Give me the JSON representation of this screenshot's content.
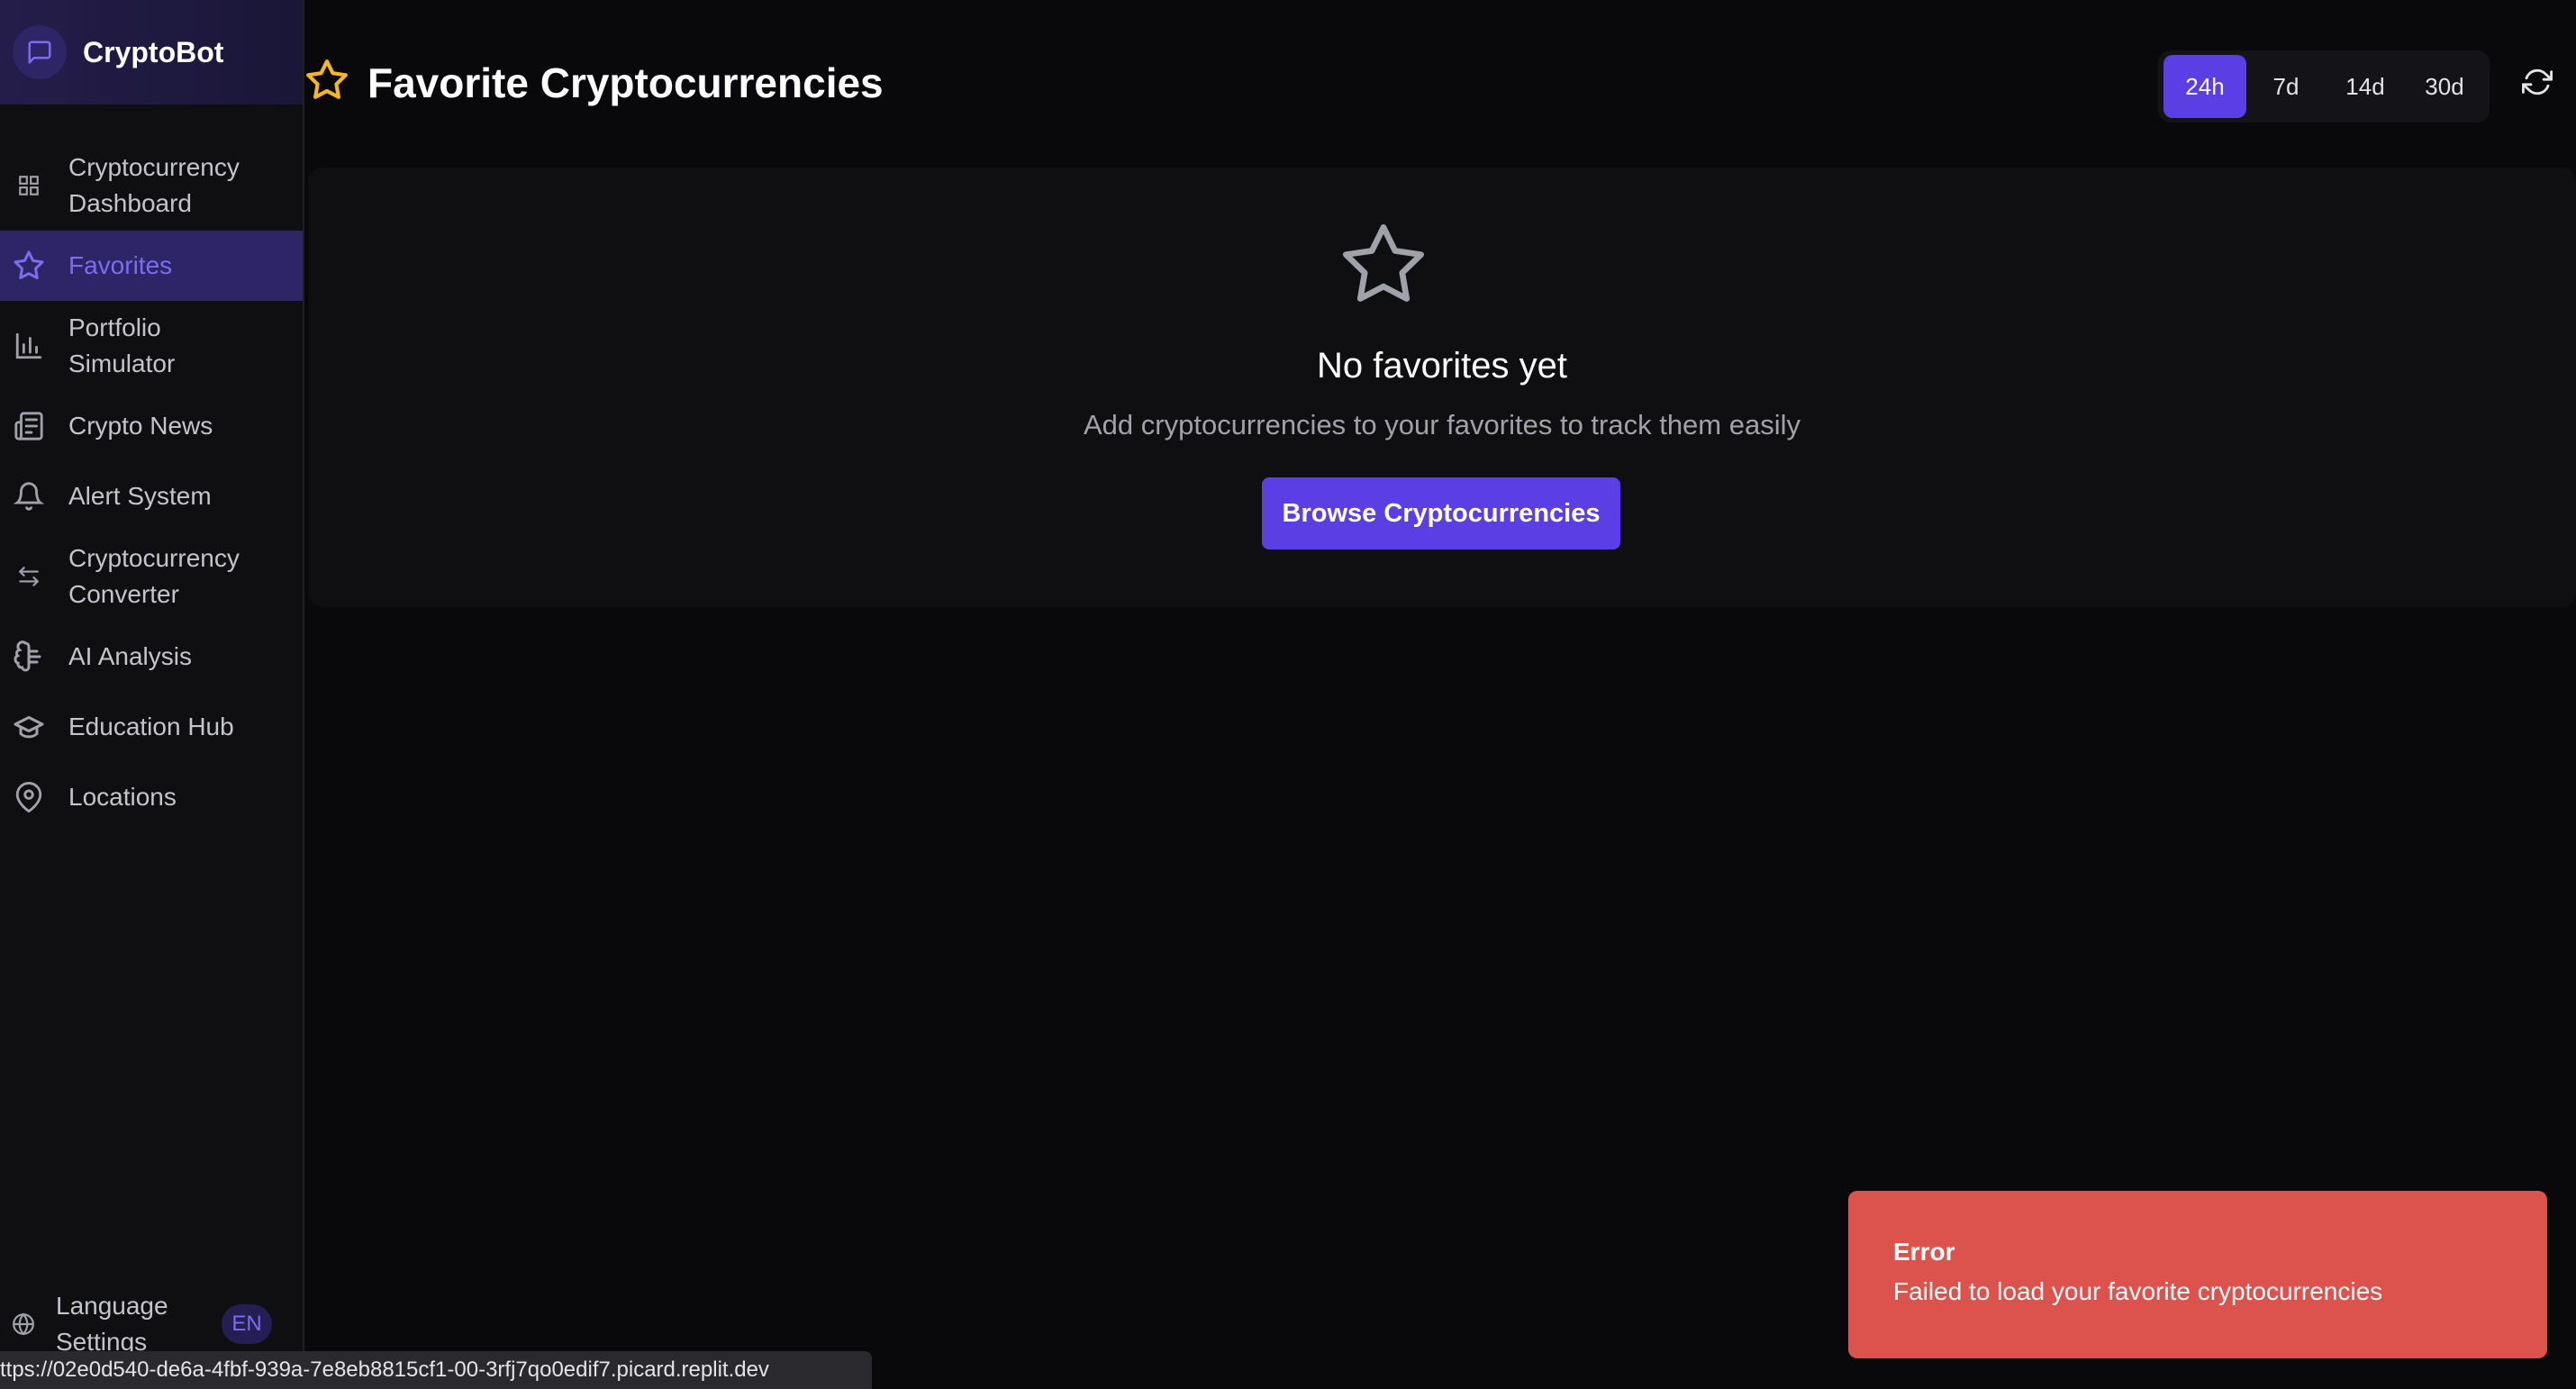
{
  "brand": {
    "name": "CryptoBot"
  },
  "sidebar": {
    "items": [
      {
        "label": "Cryptocurrency Dashboard",
        "icon": "grid-icon"
      },
      {
        "label": "Favorites",
        "icon": "star-icon"
      },
      {
        "label": "Portfolio Simulator",
        "icon": "bar-chart-icon"
      },
      {
        "label": "Crypto News",
        "icon": "newspaper-icon"
      },
      {
        "label": "Alert System",
        "icon": "bell-icon"
      },
      {
        "label": "Cryptocurrency Converter",
        "icon": "swap-arrows-icon"
      },
      {
        "label": "AI Analysis",
        "icon": "brain-icon"
      },
      {
        "label": "Education Hub",
        "icon": "graduation-cap-icon"
      },
      {
        "label": "Locations",
        "icon": "map-pin-icon"
      }
    ],
    "active": "Favorites",
    "language": {
      "label": "Language Settings",
      "code": "EN"
    }
  },
  "header": {
    "title": "Favorite Cryptocurrencies",
    "timeframes": [
      "24h",
      "7d",
      "14d",
      "30d"
    ],
    "active_timeframe": "24h"
  },
  "empty_state": {
    "title": "No favorites yet",
    "subtitle": "Add cryptocurrencies to your favorites to track them easily",
    "button_label": "Browse Cryptocurrencies"
  },
  "toast": {
    "title": "Error",
    "message": "Failed to load your favorite cryptocurrencies"
  },
  "statusbar": {
    "url": "ttps://02e0d540-de6a-4fbf-939a-7e8eb8815cf1-00-3rfj7qo0edif7.picard.replit.dev"
  },
  "colors": {
    "accent": "#5b3fe4",
    "active_nav_text": "#7c6cf0",
    "star_title": "#f5b820",
    "toast_bg": "#dc524c",
    "background": "#09090b"
  }
}
